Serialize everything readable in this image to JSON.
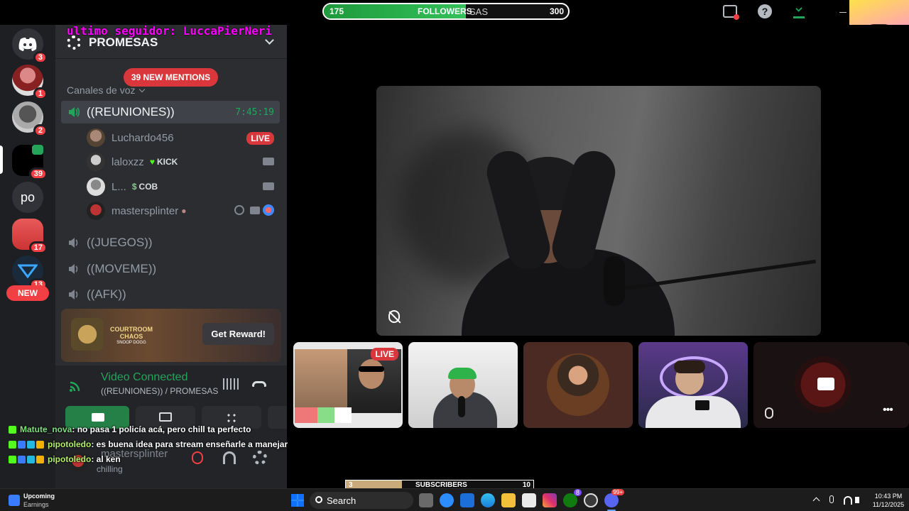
{
  "overlay": {
    "last_follower": "ultimo seguidor: LuccaPierNeri",
    "followers_bar": {
      "label": "FOLLOWERS",
      "current": "175",
      "goal": "300",
      "progress": 0.58,
      "ghost_text": "SAS"
    },
    "subs_bar": {
      "label": "SUBSCRIBERS",
      "current": "3",
      "goal": "10",
      "progress": 0.3
    }
  },
  "rail": {
    "servers": [
      {
        "name": "discord-home",
        "badge": "3"
      },
      {
        "name": "server-1",
        "badge": "1"
      },
      {
        "name": "server-2",
        "badge": "2"
      },
      {
        "name": "server-3",
        "badge": "39"
      },
      {
        "name": "server-po",
        "label": "po"
      },
      {
        "name": "server-4",
        "badge": "17"
      },
      {
        "name": "server-5",
        "badge": "13"
      }
    ],
    "new_label": "NEW"
  },
  "channels": {
    "server_name": "PROMESAS",
    "mentions_pill": "39 NEW MENTIONS",
    "category": "Canales de voz",
    "active_channel": {
      "name": "((REUNIONES))",
      "timer": "7:45:19"
    },
    "users": [
      {
        "name": "Luchardo456",
        "status": "LIVE"
      },
      {
        "name": "laloxzz",
        "tag": "KICK"
      },
      {
        "name": "L...",
        "tag": "COB"
      },
      {
        "name": "mastersplinter"
      }
    ],
    "other_channels": [
      "((JUEGOS))",
      "((MOVEME))",
      "((AFK))"
    ],
    "promo": {
      "title": "COURTROOM CHAOS",
      "subtitle": "SNOOP DOGG",
      "button": "Get Reward!"
    },
    "voice": {
      "status": "Video Connected",
      "location": "((REUNIONES)) / PROMESAS"
    },
    "user_panel": {
      "name": "mastersplinter",
      "status": "chilling"
    }
  },
  "chat": [
    {
      "user": "Matute_nova",
      "message": ": no pasa 1 policía acá, pero chill ta perfecto",
      "color": "#7ee07e"
    },
    {
      "user": "pipotoledo",
      "message": ": es buena idea para stream enseñarle a manejar",
      "color": "#b2f06c"
    },
    {
      "user": "pipotoledo",
      "message": ": al ken",
      "color": "#b2f06c"
    }
  ],
  "tiles": {
    "live_label": "LIVE"
  },
  "taskbar": {
    "widget_title": "Upcoming",
    "widget_sub": "Earnings",
    "search": "Search",
    "time": "10:43 PM",
    "date": "11/12/2025",
    "store_badge": "8",
    "discord_badge": "99+"
  },
  "colors": {
    "accent": "#23a55a",
    "danger": "#da373c",
    "mention": "#ff00ff"
  }
}
